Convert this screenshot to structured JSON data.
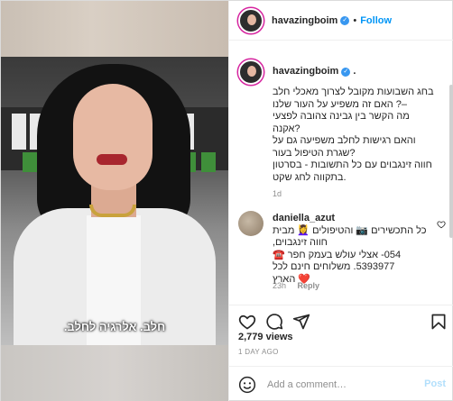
{
  "post": {
    "username": "havazingboim",
    "follow_label": "Follow",
    "dot": "•",
    "video_caption": "חלב. אלרגיה לחלב.",
    "caption": {
      "username": "havazingboim",
      "text": "בחג השבועות מקובל לצרוך מאכלי חלב\n–? האם זה משפיע על העור שלנו\nמה הקשר בין גבינה צהובה לפצעי\n?אקנה\nוהאם רגישות לחלב משפיעה גם על\n?שגרת הטיפול בעור\nחווה זינגבוים עם כל התשובות - בסרטון\n.בתקווה לחג שקט",
      "time": "1d"
    },
    "comment": {
      "username": "daniella_azut",
      "text": "כל התכשירים 📷 והטיפולים 💆‍♀️ מבית חווה זינגבוים,\n054- אצלי עולש בעמק חפר ☎️\n5393977. משלוחים חינם לכל\n❤️ הארץ",
      "time": "23h",
      "reply_label": "Reply"
    },
    "views": "2,779 views",
    "posted_ago": "1 DAY AGO",
    "add_comment_placeholder": "Add a comment…",
    "post_label": "Post"
  },
  "colors": {
    "link_blue": "#0095f6",
    "post_disabled": "#b2dffc",
    "muted": "#8e8e8e",
    "verified": "#3897f0"
  },
  "icons": [
    "verified-badge-icon",
    "heart-icon",
    "comment-icon",
    "share-icon",
    "bookmark-icon",
    "emoji-icon",
    "small-heart-icon"
  ]
}
